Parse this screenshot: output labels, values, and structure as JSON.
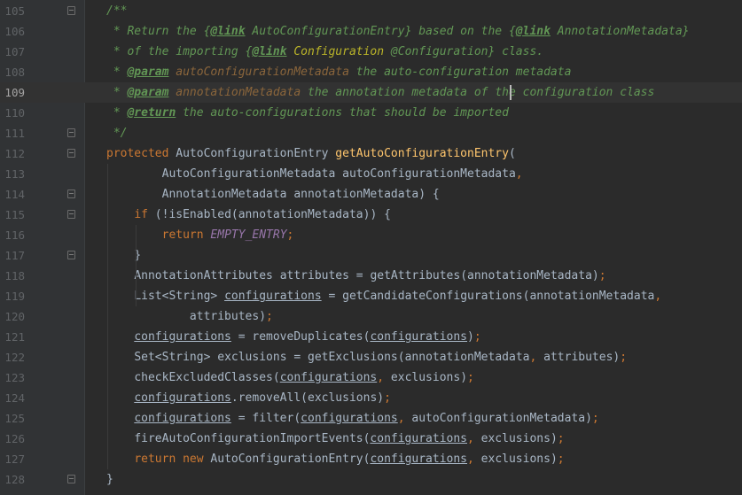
{
  "editor": {
    "lines": [
      {
        "n": "105",
        "text": "/**"
      },
      {
        "n": "106",
        "text": " * Return the {@link AutoConfigurationEntry} based on the {@link AnnotationMetadata}"
      },
      {
        "n": "107",
        "text": " * of the importing {@link Configuration @Configuration} class."
      },
      {
        "n": "108",
        "text": " * @param autoConfigurationMetadata the auto-configuration metadata"
      },
      {
        "n": "109",
        "text": " * @param annotationMetadata the annotation metadata of the configuration class"
      },
      {
        "n": "110",
        "text": " * @return the auto-configurations that should be imported"
      },
      {
        "n": "111",
        "text": " */"
      },
      {
        "n": "112",
        "text": "protected AutoConfigurationEntry getAutoConfigurationEntry("
      },
      {
        "n": "113",
        "text": "        AutoConfigurationMetadata autoConfigurationMetadata,"
      },
      {
        "n": "114",
        "text": "        AnnotationMetadata annotationMetadata) {"
      },
      {
        "n": "115",
        "text": "    if (!isEnabled(annotationMetadata)) {"
      },
      {
        "n": "116",
        "text": "        return EMPTY_ENTRY;"
      },
      {
        "n": "117",
        "text": "    }"
      },
      {
        "n": "118",
        "text": "    AnnotationAttributes attributes = getAttributes(annotationMetadata);"
      },
      {
        "n": "119",
        "text": "    List<String> configurations = getCandidateConfigurations(annotationMetadata,"
      },
      {
        "n": "120",
        "text": "            attributes);"
      },
      {
        "n": "121",
        "text": "    configurations = removeDuplicates(configurations);"
      },
      {
        "n": "122",
        "text": "    Set<String> exclusions = getExclusions(annotationMetadata, attributes);"
      },
      {
        "n": "123",
        "text": "    checkExcludedClasses(configurations, exclusions);"
      },
      {
        "n": "124",
        "text": "    configurations.removeAll(exclusions);"
      },
      {
        "n": "125",
        "text": "    configurations = filter(configurations, autoConfigurationMetadata);"
      },
      {
        "n": "126",
        "text": "    fireAutoConfigurationImportEvents(configurations, exclusions);"
      },
      {
        "n": "127",
        "text": "    return new AutoConfigurationEntry(configurations, exclusions);"
      },
      {
        "n": "128",
        "text": "}"
      }
    ],
    "current_line": "109",
    "colors": {
      "background": "#2b2b2b",
      "gutter": "#313335",
      "current_line": "#323232",
      "comment": "#629755",
      "keyword": "#cc7832",
      "method": "#ffc66d",
      "constant": "#9876aa",
      "text": "#a9b7c6"
    }
  }
}
